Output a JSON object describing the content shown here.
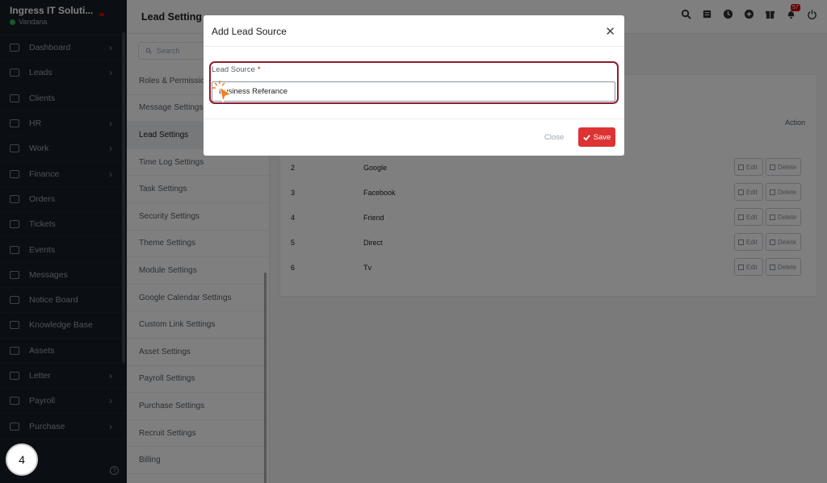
{
  "sidebar": {
    "company": "Ingress IT Soluti...",
    "user": "Vandana",
    "items": [
      {
        "label": "Dashboard",
        "arrow": true
      },
      {
        "label": "Leads",
        "arrow": true
      },
      {
        "label": "Clients",
        "arrow": false
      },
      {
        "label": "HR",
        "arrow": true
      },
      {
        "label": "Work",
        "arrow": true
      },
      {
        "label": "Finance",
        "arrow": true
      },
      {
        "label": "Orders",
        "arrow": false
      },
      {
        "label": "Tickets",
        "arrow": false
      },
      {
        "label": "Events",
        "arrow": false
      },
      {
        "label": "Messages",
        "arrow": false
      },
      {
        "label": "Notice Board",
        "arrow": false
      },
      {
        "label": "Knowledge Base",
        "arrow": false
      },
      {
        "label": "Assets",
        "arrow": false
      },
      {
        "label": "Letter",
        "arrow": true
      },
      {
        "label": "Payroll",
        "arrow": true
      },
      {
        "label": "Purchase",
        "arrow": true
      }
    ],
    "step_number": "4"
  },
  "header": {
    "title": "Lead Setting",
    "notification_count": "57"
  },
  "settings_menu": {
    "search_placeholder": "Search",
    "items": [
      "Roles & Permissions",
      "Message Settings",
      "Lead Settings",
      "Time Log Settings",
      "Task Settings",
      "Security Settings",
      "Theme Settings",
      "Module Settings",
      "Google Calendar Settings",
      "Custom Link Settings",
      "Asset Settings",
      "Payroll Settings",
      "Purchase Settings",
      "Recruit Settings",
      "Billing"
    ],
    "active_index": 2
  },
  "table": {
    "action_header": "Action",
    "edit_label": "Edit",
    "delete_label": "Delete",
    "rows": [
      {
        "num": "2",
        "name": "Google"
      },
      {
        "num": "3",
        "name": "Facebook"
      },
      {
        "num": "4",
        "name": "Friend"
      },
      {
        "num": "5",
        "name": "Direct"
      },
      {
        "num": "6",
        "name": "Tv"
      }
    ]
  },
  "modal": {
    "title": "Add Lead Source",
    "field_label": "Lead Source",
    "required_mark": "*",
    "field_value": "Business Referance",
    "close_label": "Close",
    "save_label": "Save"
  },
  "colors": {
    "sidebar_bg": "#171f29",
    "save_button": "#dd3333",
    "highlight_border": "#8e1b2e",
    "cursor": "#f57c1f"
  }
}
